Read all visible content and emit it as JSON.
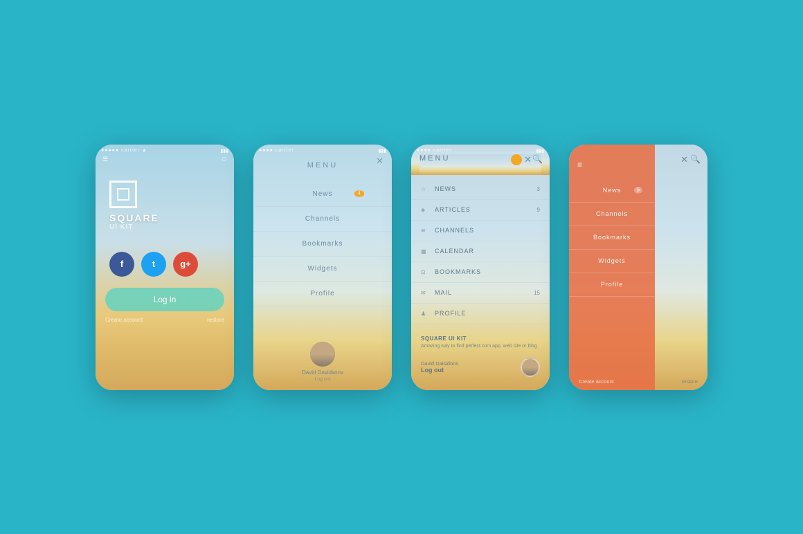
{
  "background": "#2ab4c8",
  "screens": {
    "screen1": {
      "status": "●●●●● carrier ▲",
      "battery": "▮▮▮",
      "brand": "SQUARE",
      "subtitle": "UI KIT",
      "social": {
        "facebook": "f",
        "twitter": "t",
        "google": "g+"
      },
      "login_button": "Log in",
      "create_account": "Create account",
      "restore": "restore"
    },
    "screen2": {
      "title": "MENU",
      "close": "✕",
      "items": [
        {
          "label": "News",
          "badge": "4"
        },
        {
          "label": "Channels",
          "badge": null
        },
        {
          "label": "Bookmarks",
          "badge": null
        },
        {
          "label": "Widgets",
          "badge": null
        },
        {
          "label": "Profile",
          "badge": null
        }
      ],
      "user_name": "David Davidsonv",
      "logout": "Log out"
    },
    "screen3": {
      "title": "MENU",
      "close": "✕",
      "items": [
        {
          "label": "NEWS",
          "icon": "☆",
          "badge": "3"
        },
        {
          "label": "ARTICLES",
          "icon": "◈",
          "badge": "9"
        },
        {
          "label": "CHANNELS",
          "icon": "≋",
          "badge": null
        },
        {
          "label": "CALENDAR",
          "icon": "▦",
          "badge": null
        },
        {
          "label": "BOOKMARKS",
          "icon": "⊡",
          "badge": null
        },
        {
          "label": "MAIL",
          "icon": "✉",
          "badge": "15"
        },
        {
          "label": "PROFILE",
          "icon": "♟",
          "badge": null
        }
      ],
      "promo_title": "SQUARE UI KIT",
      "promo_text": "Amazing way to find perfect.com app, web site or blog",
      "user_name": "David Daisidons",
      "logout": "Log out"
    },
    "screen4": {
      "title": "",
      "close": "✕",
      "items": [
        {
          "label": "News",
          "badge": "5"
        },
        {
          "label": "Channels",
          "badge": null
        },
        {
          "label": "Bookmarks",
          "badge": null
        },
        {
          "label": "Widgets",
          "badge": null
        },
        {
          "label": "Profile",
          "badge": null
        }
      ],
      "create_account": "Create account",
      "restore": "restore"
    }
  }
}
